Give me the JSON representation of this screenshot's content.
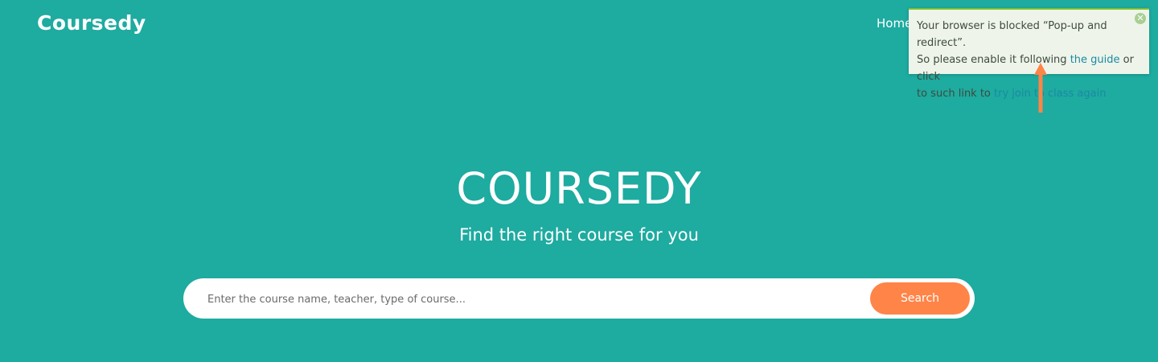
{
  "header": {
    "logo_text": "Coursedy",
    "nav": {
      "home_label": "Home"
    }
  },
  "notification": {
    "line1": "Your browser is blocked “Pop-up and redirect”.",
    "line2_prefix": "So please enable it following ",
    "guide_link": "the guide",
    "line2_suffix": " or click",
    "line3_prefix": "to such link to ",
    "retry_link": "try join to class again",
    "close_icon": "close-icon",
    "accent_color": "#7cbf34"
  },
  "annotation": {
    "arrow_color": "#ff8447",
    "icon": "arrow-up-icon"
  },
  "hero": {
    "title": "COURSEDY",
    "subtitle": "Find the right course for you"
  },
  "search": {
    "placeholder": "Enter the course name, teacher, type of course...",
    "value": "",
    "button_label": "Search",
    "button_color": "#ff8447"
  },
  "colors": {
    "background": "#1eaba0"
  }
}
